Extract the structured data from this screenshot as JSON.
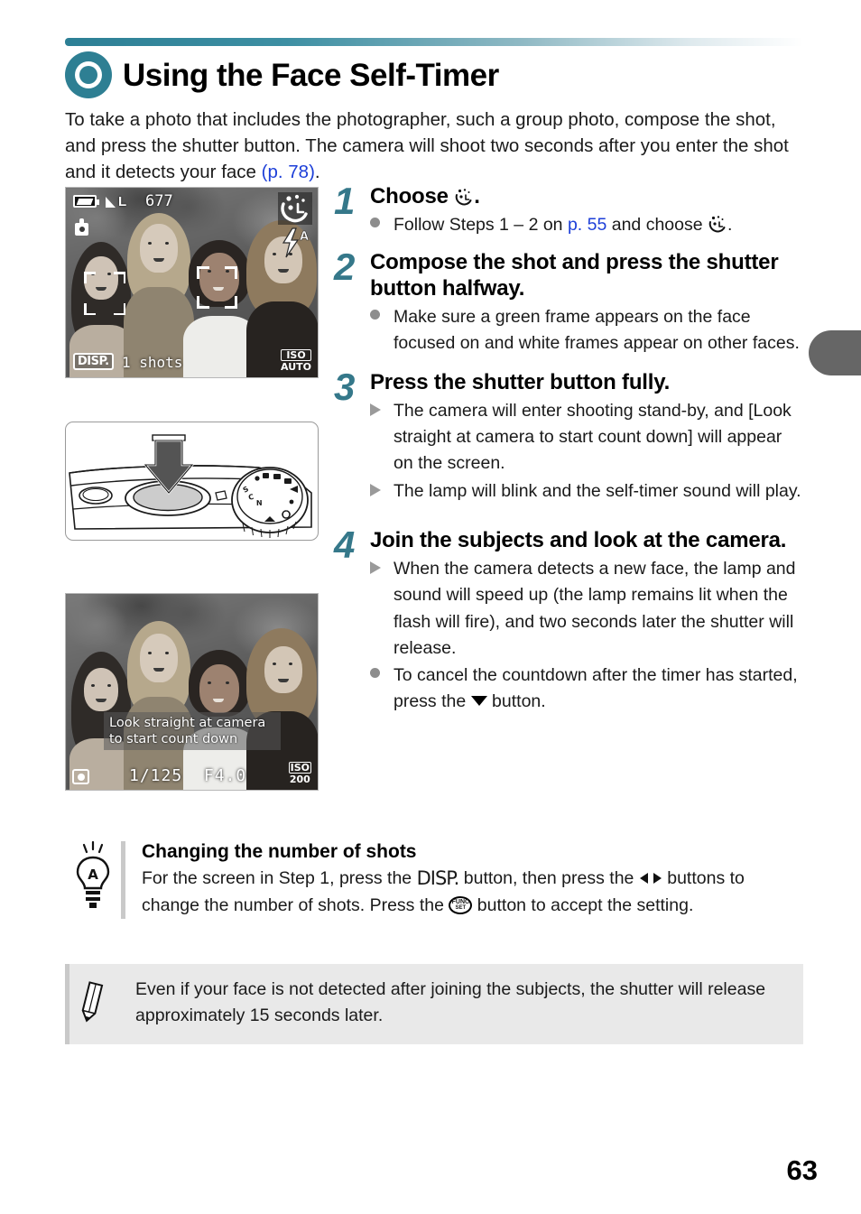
{
  "header": {
    "title": "Using the Face Self-Timer",
    "icon": "teal-ring-icon"
  },
  "intro": {
    "line1": "To take a photo that includes the photographer, such a group photo,",
    "line2": "compose the shot, and press the shutter button. The camera will shoot two",
    "line3": "seconds after you enter the shot and it detects your face ",
    "ref": "(p. 78)",
    "period": "."
  },
  "steps": [
    {
      "number": "1",
      "heading_pre": "Choose ",
      "heading_post": ".",
      "bullets": [
        {
          "marker": "dot",
          "pre": "Follow Steps 1 – 2 on ",
          "link": "p. 55",
          "mid": " and choose ",
          "post": "."
        }
      ]
    },
    {
      "number": "2",
      "heading_pre": "Compose the shot and press the shutter button halfway.",
      "heading_post": "",
      "bullets": [
        {
          "marker": "dot",
          "pre": "Make sure a green frame appears on the face focused on and white frames appear on other faces.",
          "link": "",
          "mid": "",
          "post": ""
        }
      ]
    },
    {
      "number": "3",
      "heading_pre": "Press the shutter button fully.",
      "heading_post": "",
      "bullets": [
        {
          "marker": "tri",
          "pre": "The camera will enter shooting stand-by, and [Look straight at camera to start count down] will appear on the screen.",
          "link": "",
          "mid": "",
          "post": ""
        },
        {
          "marker": "tri",
          "pre": "The lamp will blink and the self-timer sound will play.",
          "link": "",
          "mid": "",
          "post": ""
        }
      ]
    },
    {
      "number": "4",
      "heading_pre": "Join the subjects and look at the camera.",
      "heading_post": "",
      "bullets": [
        {
          "marker": "tri",
          "pre": "When the camera detects a new face, the lamp and sound will speed up (the lamp remains lit when the flash will fire), and two seconds later the shutter will release.",
          "link": "",
          "mid": "",
          "post": ""
        },
        {
          "marker": "dot",
          "pre": "To cancel the countdown after the timer has started, press the ",
          "link": "",
          "mid": "",
          "post": " button."
        }
      ]
    }
  ],
  "lcd_step1": {
    "battery": "battery-full-icon",
    "quality": "L",
    "shots_remaining": "677",
    "camera_mode_icon": "camera-mode-icon",
    "selftimer_icon": "face-self-timer-icon",
    "flash_icon": "flash-auto-icon",
    "disp_label": "DISP.",
    "shots_label": "1 shots",
    "iso_line1": "ISO",
    "iso_line2": "AUTO"
  },
  "lcd_step4": {
    "message_line1": "Look straight at camera",
    "message_line2": "to start count down",
    "metering_icon": "evaluative-metering-icon",
    "shutter_speed": "1/125",
    "aperture": "F4.0",
    "iso_line1": "ISO",
    "iso_line2": "200"
  },
  "lineart": {
    "caption": "camera-top-shutter-button-diagram",
    "dial_labels": [
      "SCN"
    ]
  },
  "tip": {
    "icon": "lightbulb-icon",
    "title": "Changing the number of shots",
    "t1": "For the screen in Step 1, press the ",
    "disp": "DISP.",
    "t2": " button, then press the ",
    "t3": " buttons to change the number of shots. Press the ",
    "func_top": "FUNC",
    "func_bottom": "SET",
    "t4": " button to accept the setting."
  },
  "note": {
    "icon": "pencil-icon",
    "text": "Even if your face is not detected after joining the subjects, the shutter will release approximately 15 seconds later."
  },
  "footer": {
    "page_number": "63"
  },
  "colors": {
    "accent_teal": "#2e7f93",
    "step_number": "#35788a",
    "link_blue": "#1d3fd8",
    "note_bg": "#e9e9e9",
    "rule_gray": "#c9c9c9",
    "tab_gray": "#666666"
  }
}
